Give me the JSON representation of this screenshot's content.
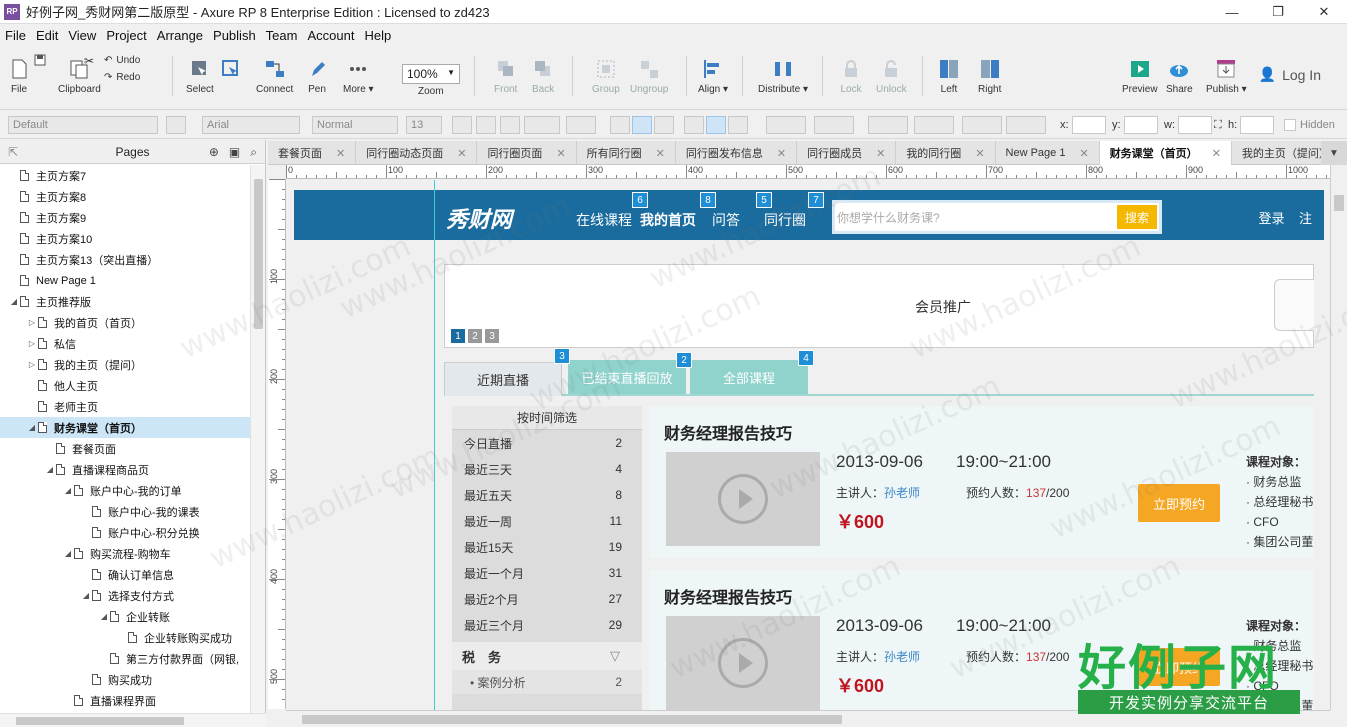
{
  "window": {
    "title": "好例子网_秀财网第二版原型 - Axure RP 8 Enterprise Edition : Licensed to zd423",
    "app_icon": "RP",
    "minimize": "—",
    "maximize": "❐",
    "close": "✕"
  },
  "menu": [
    "File",
    "Edit",
    "View",
    "Project",
    "Arrange",
    "Publish",
    "Team",
    "Account",
    "Help"
  ],
  "toolbar": {
    "file": "File",
    "clipboard": "Clipboard",
    "undo": "Undo",
    "redo": "Redo",
    "select": "Select",
    "connect": "Connect",
    "pen": "Pen",
    "more": "More ▾",
    "zoom_value": "100%",
    "zoom": "Zoom",
    "front": "Front",
    "back": "Back",
    "group": "Group",
    "ungroup": "Ungroup",
    "align": "Align ▾",
    "distribute": "Distribute ▾",
    "lock": "Lock",
    "unlock": "Unlock",
    "left": "Left",
    "right": "Right",
    "preview": "Preview",
    "share": "Share",
    "publish": "Publish ▾",
    "login": "Log In"
  },
  "format": {
    "style": "Default",
    "font": "Arial",
    "weight": "Normal",
    "size": "13",
    "x": "x:",
    "y": "y:",
    "w": "w:",
    "h": "h:",
    "hidden": "Hidden"
  },
  "pages": {
    "header": "Pages",
    "items": [
      {
        "label": "主页方案7",
        "level": 0,
        "arrow": ""
      },
      {
        "label": "主页方案8",
        "level": 0,
        "arrow": ""
      },
      {
        "label": "主页方案9",
        "level": 0,
        "arrow": ""
      },
      {
        "label": "主页方案10",
        "level": 0,
        "arrow": ""
      },
      {
        "label": "主页方案13（突出直播）",
        "level": 0,
        "arrow": ""
      },
      {
        "label": "New Page 1",
        "level": 0,
        "arrow": ""
      },
      {
        "label": "主页推荐版",
        "level": 0,
        "arrow": "◢"
      },
      {
        "label": "我的首页（首页）",
        "level": 1,
        "arrow": "▷"
      },
      {
        "label": "私信",
        "level": 1,
        "arrow": "▷"
      },
      {
        "label": "我的主页（提问）",
        "level": 1,
        "arrow": "▷"
      },
      {
        "label": "他人主页",
        "level": 1,
        "arrow": ""
      },
      {
        "label": "老师主页",
        "level": 1,
        "arrow": ""
      },
      {
        "label": "财务课堂（首页）",
        "level": 1,
        "arrow": "◢",
        "selected": true
      },
      {
        "label": "套餐页面",
        "level": 2,
        "arrow": ""
      },
      {
        "label": "直播课程商品页",
        "level": 2,
        "arrow": "◢"
      },
      {
        "label": "账户中心-我的订单",
        "level": 3,
        "arrow": "◢"
      },
      {
        "label": "账户中心-我的课表",
        "level": 4,
        "arrow": ""
      },
      {
        "label": "账户中心-积分兑换",
        "level": 4,
        "arrow": ""
      },
      {
        "label": "购买流程-购物车",
        "level": 3,
        "arrow": "◢"
      },
      {
        "label": "确认订单信息",
        "level": 4,
        "arrow": ""
      },
      {
        "label": "选择支付方式",
        "level": 4,
        "arrow": "◢"
      },
      {
        "label": "企业转账",
        "level": 5,
        "arrow": "◢"
      },
      {
        "label": "企业转账购买成功",
        "level": 6,
        "arrow": ""
      },
      {
        "label": "第三方付款界面（网银,",
        "level": 5,
        "arrow": ""
      },
      {
        "label": "购买成功",
        "level": 4,
        "arrow": ""
      },
      {
        "label": "直播课程界面",
        "level": 3,
        "arrow": ""
      }
    ]
  },
  "tabs": [
    {
      "label": "套餐页面"
    },
    {
      "label": "同行圈动态页面"
    },
    {
      "label": "同行圈页面"
    },
    {
      "label": "所有同行圈"
    },
    {
      "label": "同行圈发布信息"
    },
    {
      "label": "同行圈成员"
    },
    {
      "label": "我的同行圈"
    },
    {
      "label": "New Page 1"
    },
    {
      "label": "财务课堂（首页）",
      "active": true
    },
    {
      "label": "我的主页（提问）"
    }
  ],
  "ruler": {
    "h": [
      "0",
      "100",
      "200",
      "300",
      "400",
      "500",
      "600",
      "700",
      "800",
      "900",
      "1000"
    ],
    "v": [
      "100",
      "200",
      "300",
      "400",
      "500"
    ]
  },
  "site": {
    "logo": "秀财网",
    "nav": {
      "online": "在线课程",
      "home": "我的首页",
      "qa": "问答",
      "circle": "同行圈"
    },
    "badges": {
      "home": "6",
      "qa": "8",
      "circle": "5",
      "search": "7",
      "tab2": "3",
      "tab3": "2",
      "tab4": "4"
    },
    "search_placeholder": "你想学什么财务课?",
    "search_button": "搜索",
    "login": "登录",
    "register": "注",
    "banner": "会员推广",
    "banner_dots": [
      "1",
      "2",
      "3"
    ],
    "course_tabs": [
      "近期直播",
      "已结束直播回放",
      "全部课程"
    ]
  },
  "filter": {
    "header": "按时间筛选",
    "rows": [
      {
        "label": "今日直播",
        "count": "2"
      },
      {
        "label": "最近三天",
        "count": "4"
      },
      {
        "label": "最近五天",
        "count": "8"
      },
      {
        "label": "最近一周",
        "count": "11"
      },
      {
        "label": "最近15天",
        "count": "19"
      },
      {
        "label": "最近一个月",
        "count": "31"
      },
      {
        "label": "最近2个月",
        "count": "27"
      },
      {
        "label": "最近三个月",
        "count": "29"
      }
    ],
    "category": "税　务",
    "category_arrow": "▽",
    "sub": {
      "label": "• 案例分析",
      "count": "2"
    }
  },
  "courses": [
    {
      "title": "财务经理报告技巧",
      "date": "2013-09-06",
      "time": "19:00~21:00",
      "speaker_label": "主讲人：",
      "speaker": "孙老师",
      "booking_label": "预约人数：",
      "booked": "137",
      "capacity": "/200",
      "price": "￥600",
      "book_button": "立即预约",
      "audience_label": "课程对象：",
      "audience": [
        "· 财务总监",
        "· 总经理秘书",
        "· CFO",
        "· 集团公司董"
      ]
    },
    {
      "title": "财务经理报告技巧",
      "date": "2013-09-06",
      "time": "19:00~21:00",
      "speaker_label": "主讲人：",
      "speaker": "孙老师",
      "booking_label": "预约人数：",
      "booked": "137",
      "capacity": "/200",
      "price": "￥600",
      "book_button": "立即预约",
      "audience_label": "课程对象：",
      "audience": [
        "· 财务总监",
        "· 总经理秘书",
        "· CFO",
        "· 集团公司董"
      ]
    }
  ],
  "watermark": "www.haolizi.com",
  "corner_logo": {
    "big": "好例子网",
    "small": "开发实例分享交流平台"
  },
  "colors": {
    "brand_blue": "#1a6b9e",
    "teal": "#8fd3cc",
    "orange": "#f5a623",
    "price_red": "#c0141e",
    "badge_blue": "#1e8fd6"
  }
}
